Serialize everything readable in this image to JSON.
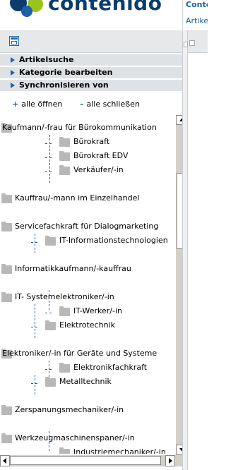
{
  "header": {
    "logo_text": "contenido",
    "link_top": "Conte",
    "link_sub": "Artike"
  },
  "toolbar": {
    "icon": "frame-icon"
  },
  "sections": [
    {
      "label": "Artikelsuche"
    },
    {
      "label": "Kategorie bearbeiten"
    },
    {
      "label": "Synchronisieren von"
    }
  ],
  "expand": {
    "open_symbol": "+",
    "open_label": "alle öffnen",
    "close_symbol": "–",
    "close_label": "alle schließen"
  },
  "tree": [
    {
      "label": "Kaufmann/-frau für Bürokommunikation"
    },
    {
      "label": "Bürokraft"
    },
    {
      "label": "Bürokraft EDV"
    },
    {
      "label": "Verkäufer/-in"
    },
    {
      "label": "Kauffrau/-mann im Einzelhandel"
    },
    {
      "label": "Servicefachkraft für Dialogmarketing"
    },
    {
      "label": "IT-Informationstechnologien"
    },
    {
      "label": "Informatikkaufmann/-kauffrau"
    },
    {
      "label": "IT- Systemelektroniker/-in"
    },
    {
      "label": "IT-Werker/-in"
    },
    {
      "label": "Elektrotechnik"
    },
    {
      "label": "Elektroniker/-in für Geräte und Systeme"
    },
    {
      "label": "Elektronikfachkraft"
    },
    {
      "label": "Metalltechnik"
    },
    {
      "label": "Zerspanungsmechaniker/-in"
    },
    {
      "label": "Werkzeugmaschinenspaner/-in"
    },
    {
      "label": "Industriemechaniker/-in"
    }
  ],
  "colors": {
    "accent": "#1f5fa8",
    "section_bg": "#dfe2e5",
    "scrollbar": "#d4d0c8"
  }
}
